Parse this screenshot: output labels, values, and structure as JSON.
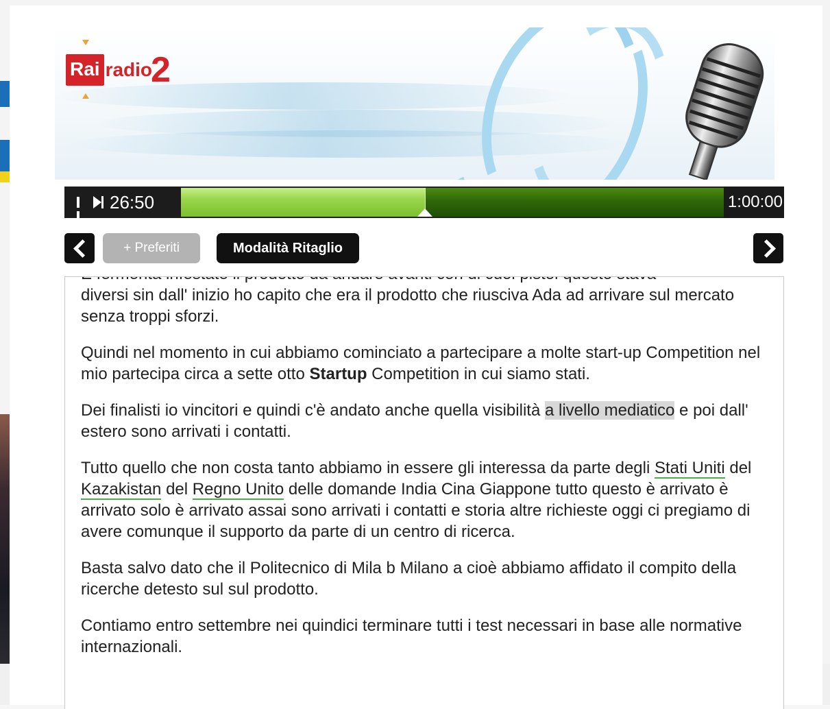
{
  "player": {
    "elapsed": "26:50",
    "duration": "1:00:00",
    "progress_fraction": 0.45
  },
  "toolbar": {
    "favorites_label": "+ Preferiti",
    "crop_mode_label": "Modalità Ritaglio"
  },
  "transcript": {
    "p0": "E fermenta infestate il prodotto da andare avanti con di cuoi pistol questo stava",
    "p1": "diversi sin dall' inizio ho capito che era il prodotto che riusciva Ada ad arrivare sul mercato senza troppi sforzi.",
    "p2_a": "Quindi nel momento in cui abbiamo cominciato a partecipare a molte start-up Competition nel mio partecipa circa a sette otto ",
    "p2_bold": "Startup",
    "p2_b": " Competition in cui siamo stati.",
    "p3_a": "Dei finalisti io vincitori e quindi c'è andato anche quella visibilità ",
    "p3_hl": "a livello mediatico",
    "p3_b": " e poi dall' estero sono arrivati i contatti.",
    "p4_a": "Tutto quello che non costa tanto abbiamo in essere gli interessa da parte degli ",
    "p4_e1": "Stati Uniti",
    "p4_b": " del ",
    "p4_e2": "Kazakistan",
    "p4_c": " del ",
    "p4_e3": "Regno Unito",
    "p4_d": " delle domande India Cina Giappone tutto questo è arrivato è arrivato solo è arrivato assai sono arrivati i contatti e storia altre richieste oggi ci pregiamo di avere comunque il supporto da parte di un centro di ricerca.",
    "p5": "Basta salvo dato che il Politecnico di Mila b Milano a cioè abbiamo affidato il compito della ricerche detesto sul sul prodotto.",
    "p6": "Contiamo entro settembre nei quindici terminare tutti i test necessari in base alle normative internazionali."
  },
  "logo": {
    "rai": "Rai",
    "radio": "radio",
    "two": "2"
  },
  "colors": {
    "rai_red": "#d4242a",
    "progress_played": "#98d54a",
    "progress_remaining": "#2f6808",
    "entity_underline": "#4caf4a",
    "highlight": "#d8d8d8"
  }
}
